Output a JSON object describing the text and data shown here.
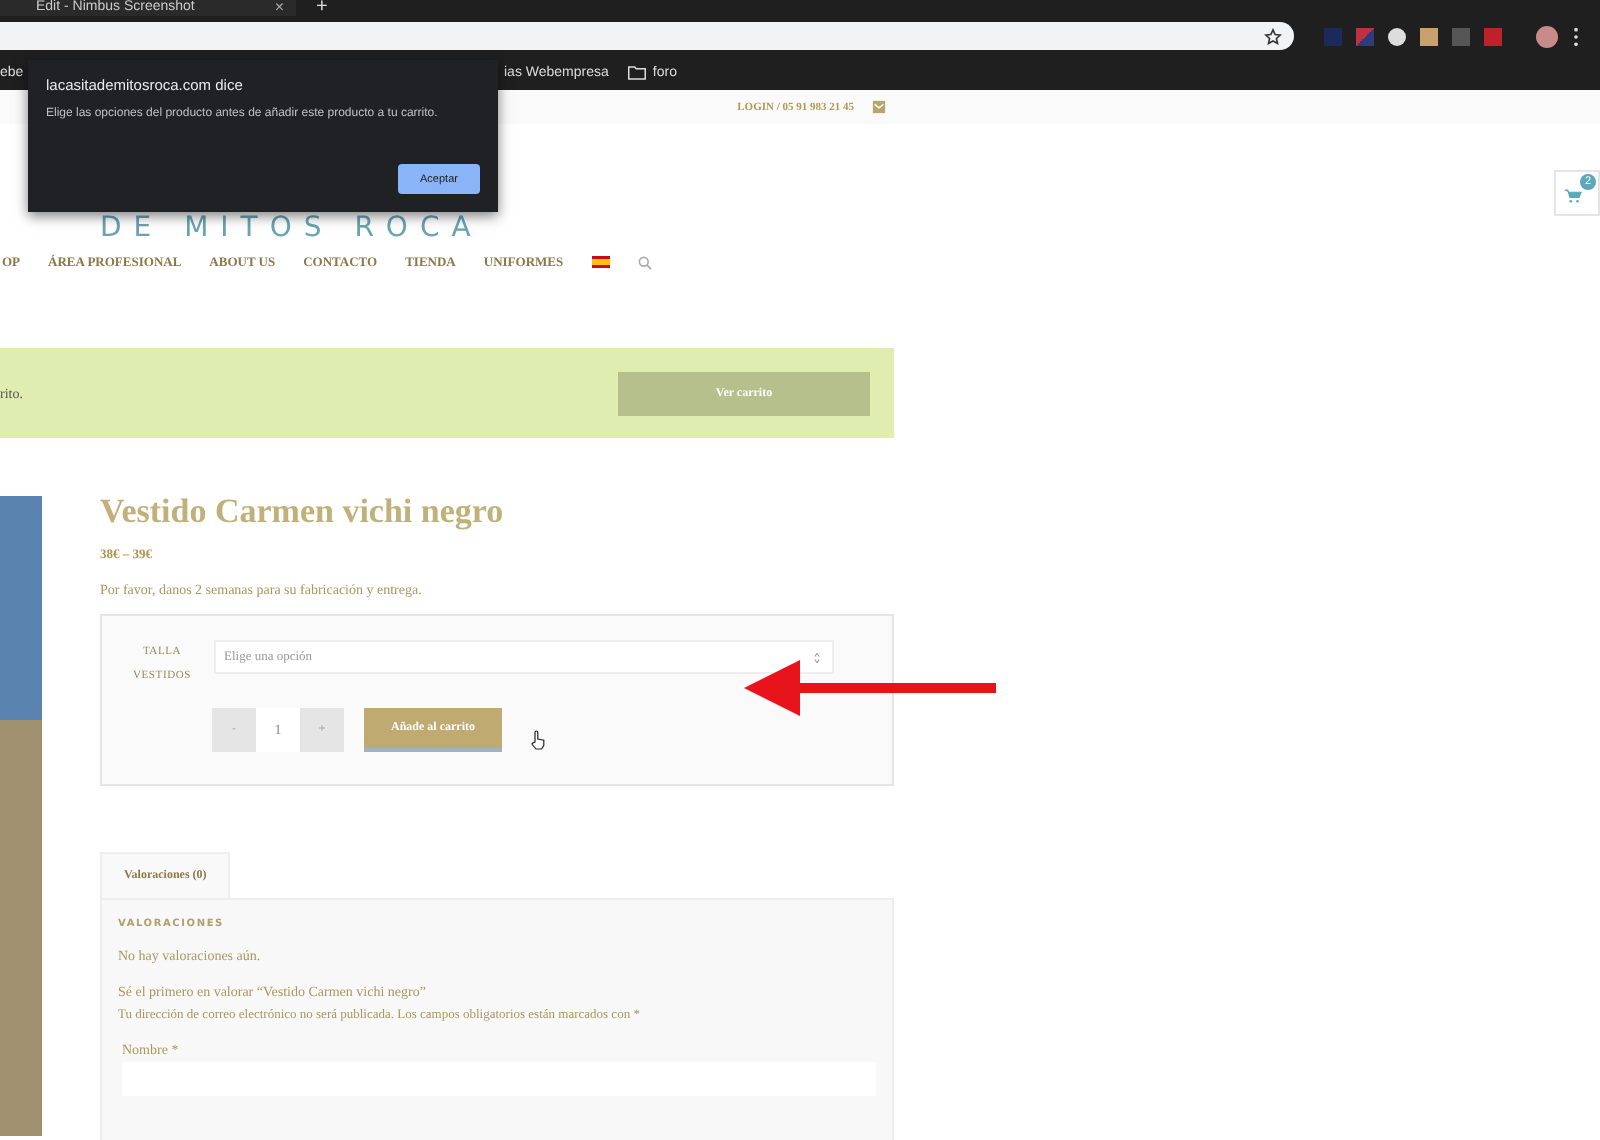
{
  "browser": {
    "tab_title": "Edit - Nimbus Screenshot",
    "tab_close": "×",
    "new_tab": "+",
    "bookmarks": [
      {
        "label": "ebe",
        "kind": "page"
      },
      {
        "label": "ias Webempresa",
        "kind": "page"
      },
      {
        "label": "foro",
        "kind": "folder"
      }
    ]
  },
  "dialog": {
    "title": "lacasitademitosroca.com dice",
    "message": "Elige las opciones del producto antes de añadir este producto a tu carrito.",
    "button": "Aceptar"
  },
  "topbar": {
    "login": "LOGIN / 05 91 983 21 45"
  },
  "logo": "DE MITOS ROCA",
  "cart": {
    "count": "2"
  },
  "nav": [
    "OP",
    "ÁREA PROFESIONAL",
    "ABOUT US",
    "CONTACTO",
    "TIENDA",
    "UNIFORMES"
  ],
  "notice": {
    "message": "rito.",
    "button": "Ver carrito"
  },
  "product": {
    "title": "Vestido Carmen vichi negro",
    "price": "38€ – 39€",
    "note": "Por favor, danos 2 semanas para su fabricación y entrega.",
    "option_label": "TALLA VESTIDOS",
    "option_placeholder": "Elige una opción",
    "quantity": "1",
    "minus": "-",
    "plus": "+",
    "add_button": "Añade al carrito"
  },
  "tabs": [
    {
      "label": "Valoraciones (0)",
      "selected": true
    }
  ],
  "reviews": {
    "heading": "VALORACIONES",
    "empty": "No hay valoraciones aún.",
    "first": "Sé el primero en valorar “Vestido Carmen vichi negro”",
    "notice": "Tu dirección de correo electrónico no será publicada. Los campos obligatorios están marcados con *",
    "name_label": "Nombre *"
  }
}
